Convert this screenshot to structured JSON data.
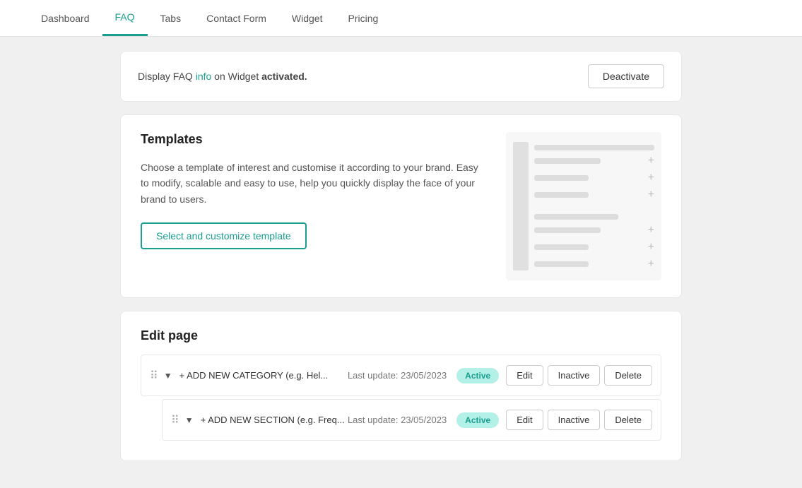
{
  "nav": {
    "items": [
      {
        "label": "Dashboard",
        "active": false
      },
      {
        "label": "FAQ",
        "active": true
      },
      {
        "label": "Tabs",
        "active": false
      },
      {
        "label": "Contact Form",
        "active": false
      },
      {
        "label": "Widget",
        "active": false
      },
      {
        "label": "Pricing",
        "active": false
      }
    ]
  },
  "activation": {
    "text_prefix": "Display FAQ info on Widget ",
    "link_text": "info",
    "text_suffix": " on Widget ",
    "status": "activated.",
    "deactivate_label": "Deactivate"
  },
  "templates": {
    "title": "Templates",
    "description": "Choose a template of interest and customise it according to your brand. Easy to modify, scalable and easy to use, help you quickly display the face of your brand to users.",
    "button_label": "Select and customize template"
  },
  "edit_page": {
    "title": "Edit page",
    "rows": [
      {
        "label": "+ ADD NEW CATEGORY (e.g. Hel...",
        "last_update": "Last update: 23/05/2023",
        "status": "Active",
        "edit_label": "Edit",
        "inactive_label": "Inactive",
        "delete_label": "Delete",
        "nested": false
      },
      {
        "label": "+ ADD NEW SECTION (e.g. Freq...",
        "last_update": "Last update: 23/05/2023",
        "status": "Active",
        "edit_label": "Edit",
        "inactive_label": "Inactive",
        "delete_label": "Delete",
        "nested": true
      }
    ]
  }
}
